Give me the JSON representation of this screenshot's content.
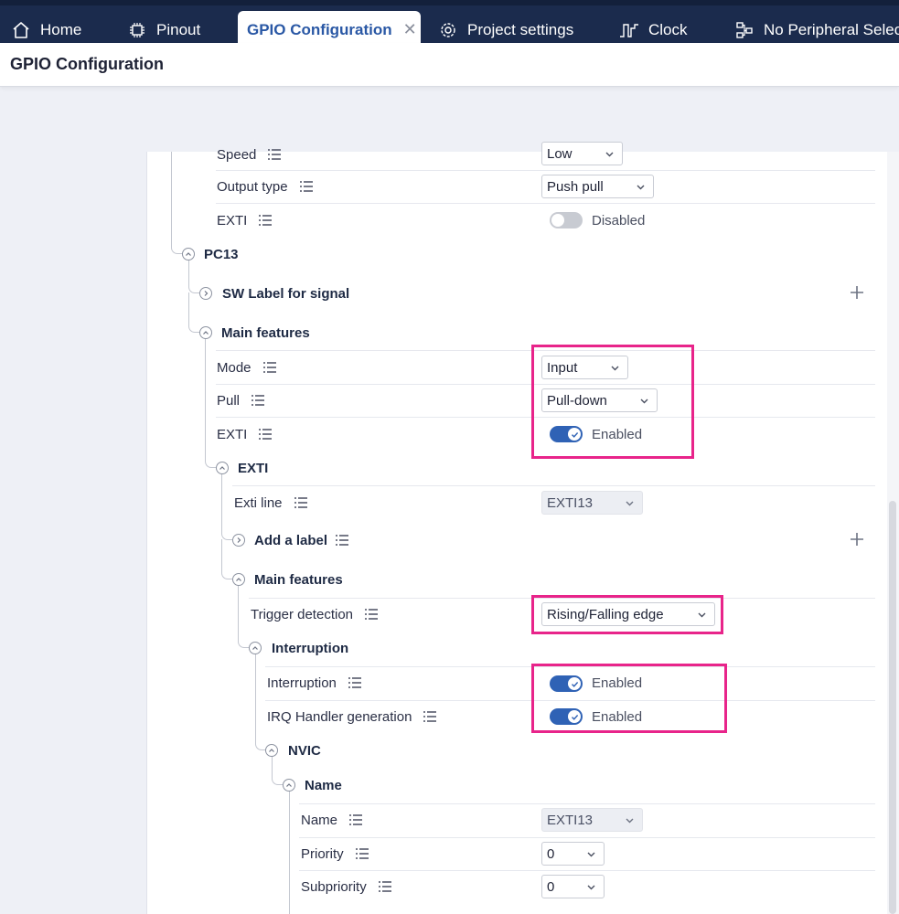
{
  "tabs": [
    {
      "label": "Home",
      "icon": "home-icon"
    },
    {
      "label": "Pinout",
      "icon": "chip-icon"
    },
    {
      "label": "GPIO Configuration",
      "icon": "",
      "active": true
    },
    {
      "label": "Project settings",
      "icon": "settings-icon"
    },
    {
      "label": "Clock",
      "icon": "clock-signal-icon"
    },
    {
      "label": "No Peripheral Selec",
      "icon": "peripheral-icon"
    }
  ],
  "page_title": "GPIO Configuration",
  "rows": {
    "speed": {
      "label": "Speed",
      "value": "Low"
    },
    "output_type": {
      "label": "Output type",
      "value": "Push pull"
    },
    "exti_top": {
      "label": "EXTI",
      "value": "Disabled"
    },
    "pc13": {
      "label": "PC13"
    },
    "sw_label": {
      "label": "SW Label for signal"
    },
    "main_features_1": {
      "label": "Main features"
    },
    "mode": {
      "label": "Mode",
      "value": "Input"
    },
    "pull": {
      "label": "Pull",
      "value": "Pull-down"
    },
    "exti": {
      "label": "EXTI",
      "value": "Enabled"
    },
    "exti_group": {
      "label": "EXTI"
    },
    "exti_line": {
      "label": "Exti line",
      "value": "EXTI13"
    },
    "add_label": {
      "label": "Add a label"
    },
    "main_features_2": {
      "label": "Main features"
    },
    "trigger": {
      "label": "Trigger detection",
      "value": "Rising/Falling edge"
    },
    "interruption_group": {
      "label": "Interruption"
    },
    "interruption": {
      "label": "Interruption",
      "value": "Enabled"
    },
    "irq": {
      "label": "IRQ Handler generation",
      "value": "Enabled"
    },
    "nvic": {
      "label": "NVIC"
    },
    "name_group": {
      "label": "Name"
    },
    "name": {
      "label": "Name",
      "value": "EXTI13"
    },
    "priority": {
      "label": "Priority",
      "value": "0"
    },
    "subpriority": {
      "label": "Subpriority",
      "value": "0"
    }
  },
  "colors": {
    "topbar": "#1b2b4d",
    "active_tab_text": "#2a58a5",
    "toggle_on": "#2f62b5",
    "highlight": "#e8248a"
  }
}
